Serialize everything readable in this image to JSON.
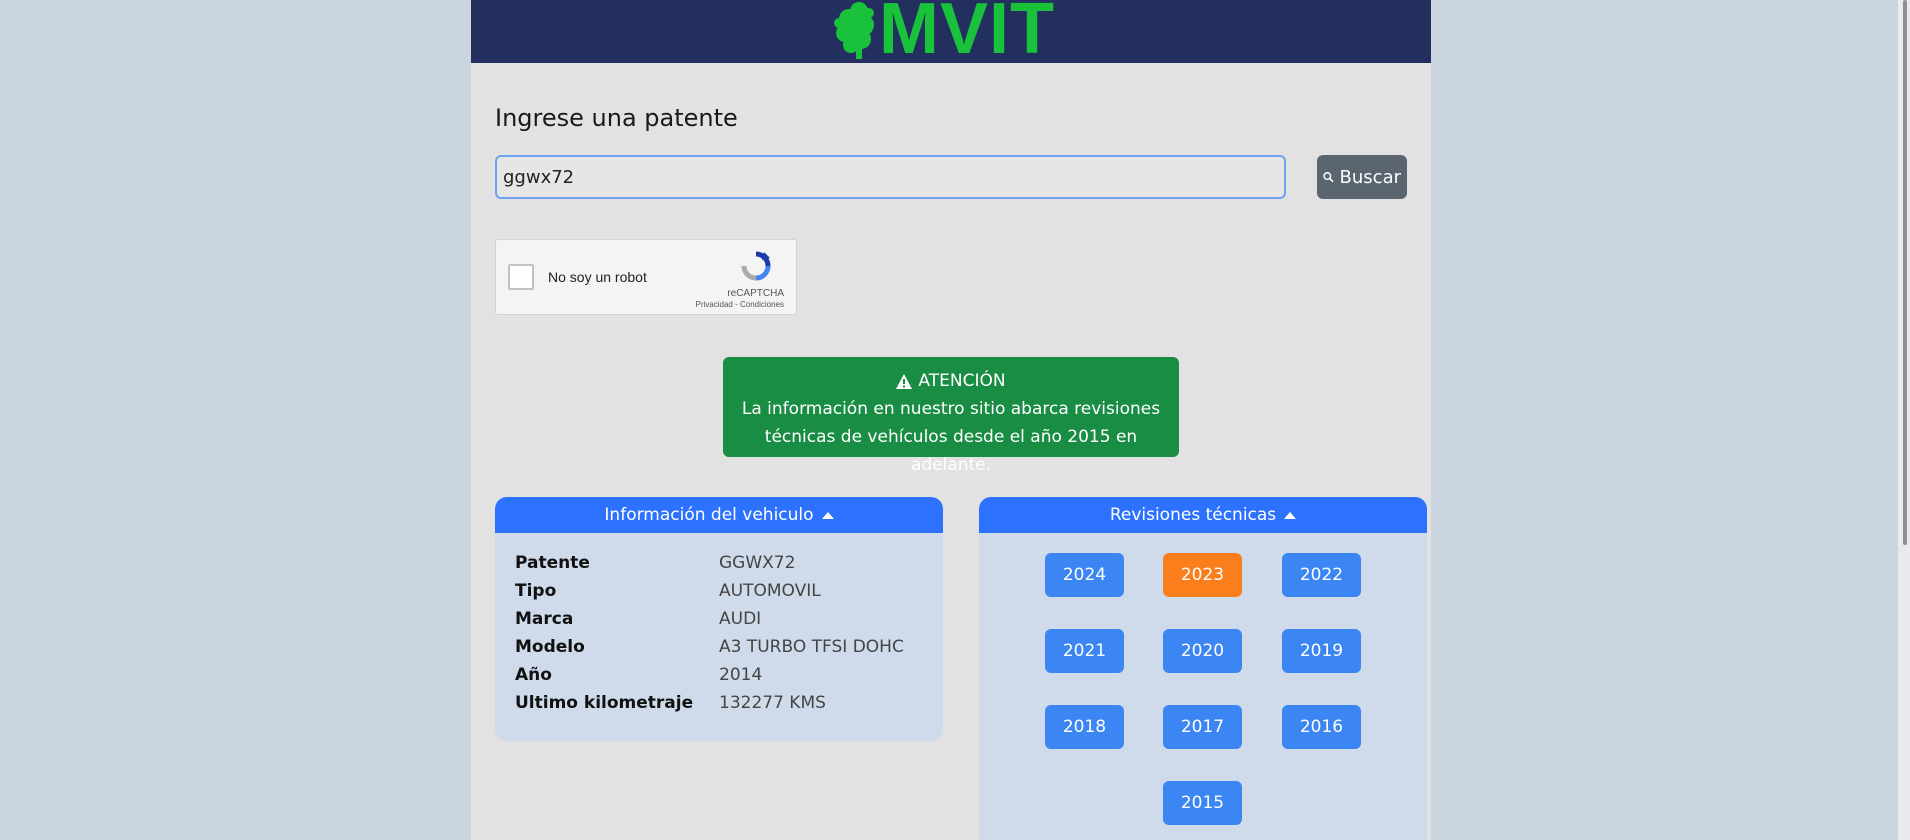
{
  "header": {
    "logo_text": "MVIT"
  },
  "search": {
    "title": "Ingrese una patente",
    "value": "ggwx72",
    "button_label": "Buscar"
  },
  "captcha": {
    "label": "No soy un robot",
    "brand": "reCAPTCHA",
    "links": "Privacidad - Condiciones"
  },
  "alert": {
    "title": "ATENCIÓN",
    "line1": "La información en nuestro sitio abarca revisiones",
    "line2": "técnicas de vehículos desde el año 2015 en adelante.",
    "color": "#198d43"
  },
  "vehicle": {
    "header": "Información del vehiculo",
    "rows": [
      {
        "label": "Patente",
        "value": "GGWX72"
      },
      {
        "label": "Tipo",
        "value": "AUTOMOVIL"
      },
      {
        "label": "Marca",
        "value": "AUDI"
      },
      {
        "label": "Modelo",
        "value": "A3 TURBO TFSI DOHC"
      },
      {
        "label": "Año",
        "value": "2014"
      },
      {
        "label": "Ultimo kilometraje",
        "value": "132277 KMS"
      }
    ]
  },
  "revisions": {
    "header": "Revisiones técnicas",
    "years": [
      "2024",
      "2023",
      "2022",
      "2021",
      "2020",
      "2019",
      "2018",
      "2017",
      "2016",
      "2015"
    ],
    "selected": "2023"
  },
  "colors": {
    "header_bg": "#222f5f",
    "logo_green": "#19c23a",
    "card_header": "#2d72fe",
    "year_button": "#3b86f2",
    "year_selected": "#fb7e1d"
  }
}
